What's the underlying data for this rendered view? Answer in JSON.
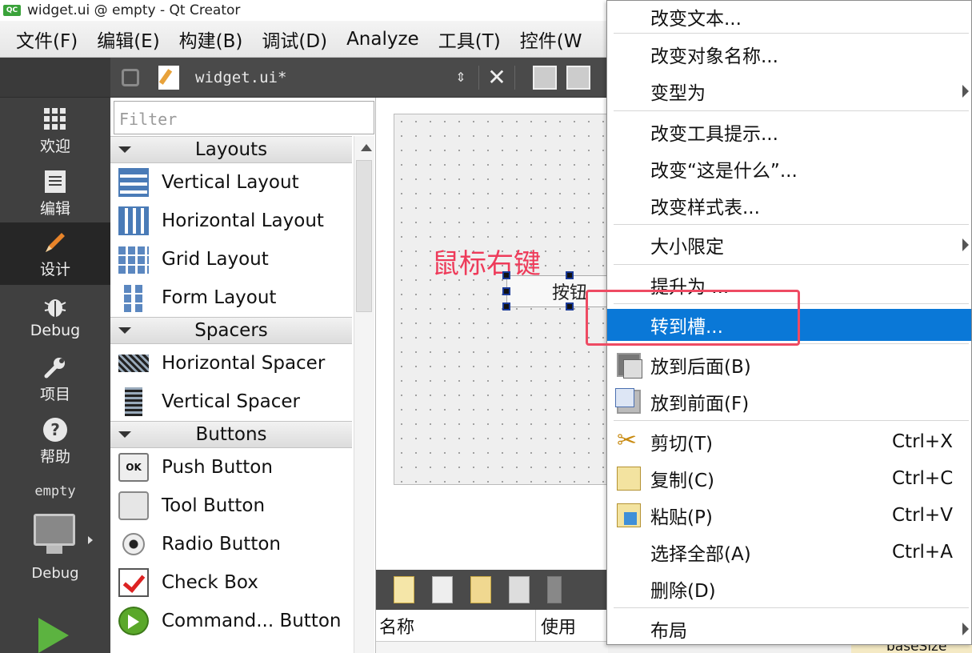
{
  "window": {
    "logo_text": "QC",
    "title": "widget.ui @ empty - Qt Creator"
  },
  "menubar": {
    "items": [
      "文件(F)",
      "编辑(E)",
      "构建(B)",
      "调试(D)",
      "Analyze",
      "工具(T)",
      "控件(W"
    ]
  },
  "modebar": {
    "modes": [
      {
        "label": "欢迎",
        "icon": "grid-icon"
      },
      {
        "label": "编辑",
        "icon": "document-icon"
      },
      {
        "label": "设计",
        "icon": "pencil-icon",
        "active": true
      },
      {
        "label": "Debug",
        "icon": "bug-icon"
      },
      {
        "label": "项目",
        "icon": "wrench-icon"
      },
      {
        "label": "帮助",
        "icon": "help-icon"
      }
    ],
    "target_name": "empty",
    "target_config": "Debug"
  },
  "editor_toolbar": {
    "filename": "widget.ui*",
    "updown": "⇕",
    "close": "✕"
  },
  "widget_box": {
    "filter_placeholder": "Filter",
    "categories": [
      {
        "name": "Layouts",
        "items": [
          "Vertical Layout",
          "Horizontal Layout",
          "Grid Layout",
          "Form Layout"
        ]
      },
      {
        "name": "Spacers",
        "items": [
          "Horizontal Spacer",
          "Vertical Spacer"
        ]
      },
      {
        "name": "Buttons",
        "items": [
          "Push Button",
          "Tool Button",
          "Radio Button",
          "Check Box",
          "Command... Button"
        ]
      }
    ],
    "push_button_icon_text": "OK"
  },
  "form": {
    "annotation": "鼠标右键",
    "push_button_text": "按钮"
  },
  "action_editor": {
    "col_name": "名称",
    "col_used": "使用"
  },
  "property_peek": "baseSize",
  "context_menu": {
    "items": [
      {
        "label": "改变文本..."
      },
      {
        "label": "改变对象名称..."
      },
      {
        "label": "变型为",
        "submenu": true
      },
      {
        "label": "改变工具提示..."
      },
      {
        "label": "改变“这是什么”..."
      },
      {
        "label": "改变样式表..."
      },
      {
        "label": "大小限定",
        "submenu": true
      },
      {
        "label": "提升为 ..."
      },
      {
        "label": "转到槽...",
        "highlighted": true
      },
      {
        "label": "放到后面(B)",
        "icon": "send-to-back-icon"
      },
      {
        "label": "放到前面(F)",
        "icon": "bring-to-front-icon"
      },
      {
        "label": "剪切(T)",
        "icon": "cut-icon",
        "shortcut": "Ctrl+X"
      },
      {
        "label": "复制(C)",
        "icon": "copy-icon",
        "shortcut": "Ctrl+C"
      },
      {
        "label": "粘贴(P)",
        "icon": "paste-icon",
        "shortcut": "Ctrl+V"
      },
      {
        "label": "选择全部(A)",
        "shortcut": "Ctrl+A"
      },
      {
        "label": "删除(D)"
      },
      {
        "label": "布局",
        "submenu": true
      }
    ]
  },
  "colors": {
    "highlight": "#0a78d7",
    "annotation": "#ee3b5a",
    "modebar_bg": "#404040",
    "run_green": "#5cb340"
  }
}
